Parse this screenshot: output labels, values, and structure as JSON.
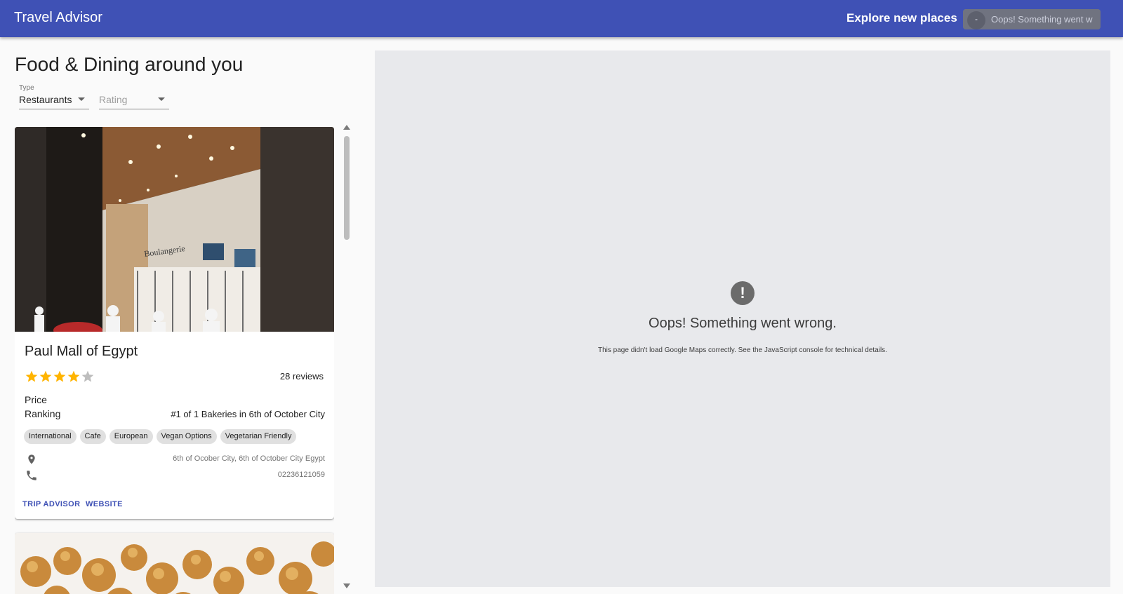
{
  "app": {
    "title": "Travel Advisor",
    "explore_label": "Explore new places",
    "search_overlay_text": "Oops! Something went w"
  },
  "list": {
    "title": "Food & Dining around you",
    "type_select": {
      "label": "Type",
      "value": "Restaurants"
    },
    "rating_select": {
      "placeholder": "Rating"
    }
  },
  "places": [
    {
      "name": "Paul Mall of Egypt",
      "rating": 4,
      "rating_max": 5,
      "reviews": "28 reviews",
      "price_label": "Price",
      "ranking_label": "Ranking",
      "ranking": "#1 of 1 Bakeries in 6th of October City",
      "cuisines": [
        "International",
        "Cafe",
        "European",
        "Vegan Options",
        "Vegetarian Friendly"
      ],
      "address": "6th of Ocober City, 6th of October City Egypt",
      "phone": "02236121059",
      "actions": {
        "trip_advisor": "TRIP ADVISOR",
        "website": "WEBSITE"
      }
    }
  ],
  "map": {
    "error_title": "Oops! Something went wrong.",
    "error_desc": "This page didn't load Google Maps correctly. See the JavaScript console for technical details."
  },
  "colors": {
    "primary": "#3f51b5",
    "star": "#ffb400",
    "star_empty": "#bdbdbd",
    "map_bg": "#e8e9ec"
  }
}
